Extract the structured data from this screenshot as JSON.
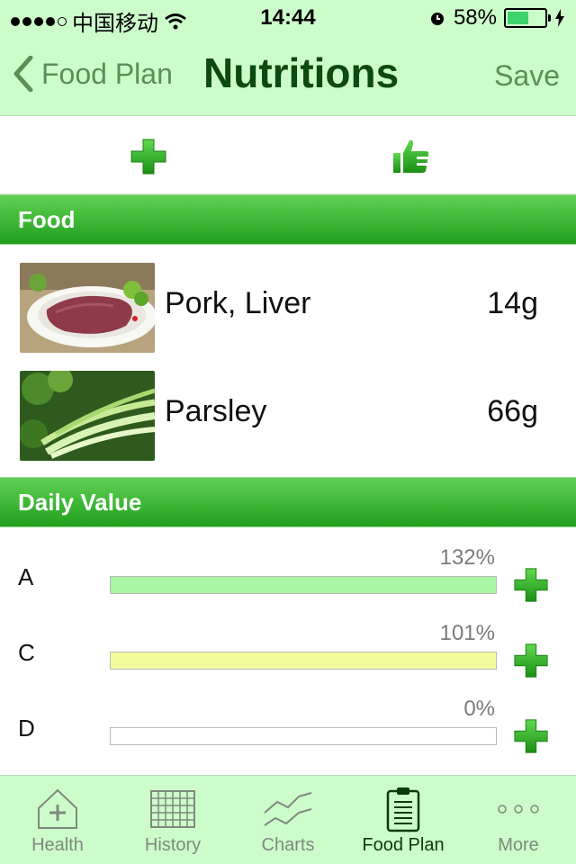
{
  "status_bar": {
    "carrier": "中国移动",
    "time": "14:44",
    "battery": "58%",
    "battery_level": 0.58
  },
  "nav": {
    "back_label": "Food Plan",
    "title": "Nutritions",
    "save_label": "Save"
  },
  "toolbar": {
    "add_icon": "plus-icon",
    "like_icon": "thumbs-up-icon"
  },
  "sections": {
    "food": "Food",
    "daily_value": "Daily Value"
  },
  "foods": [
    {
      "name": "Pork, Liver",
      "amount": "14g",
      "image": "pork-liver-photo"
    },
    {
      "name": "Parsley",
      "amount": "66g",
      "image": "parsley-photo"
    }
  ],
  "daily_values": [
    {
      "label": "A",
      "percent": "132%",
      "value": 1.32,
      "color": "#a8f5a3"
    },
    {
      "label": "C",
      "percent": "101%",
      "value": 1.01,
      "color": "#f3fb9c"
    },
    {
      "label": "D",
      "percent": "0%",
      "value": 0.0,
      "color": "#ffffff"
    }
  ],
  "tabs": [
    {
      "label": "Health",
      "icon": "health-icon",
      "active": false
    },
    {
      "label": "History",
      "icon": "history-icon",
      "active": false
    },
    {
      "label": "Charts",
      "icon": "charts-icon",
      "active": false
    },
    {
      "label": "Food Plan",
      "icon": "food-plan-icon",
      "active": true
    },
    {
      "label": "More",
      "icon": "more-icon",
      "active": false
    }
  ],
  "colors": {
    "nav_bg": "#cdfccb",
    "section_green": "#1f9f1b",
    "title_green": "#0d4a0f"
  }
}
